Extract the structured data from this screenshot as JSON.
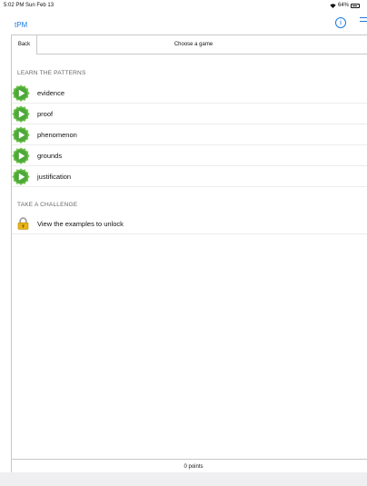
{
  "status_bar": {
    "time": "5:02 PM  Sun Feb 13",
    "battery": "64%"
  },
  "nav": {
    "title": "tPM"
  },
  "header": {
    "back_label": "Back",
    "title": "Choose a game"
  },
  "sections": {
    "learn": {
      "label": "LEARN THE PATTERNS",
      "items": [
        {
          "label": "evidence"
        },
        {
          "label": "proof"
        },
        {
          "label": "phenomenon"
        },
        {
          "label": "grounds"
        },
        {
          "label": "justification"
        }
      ]
    },
    "challenge": {
      "label": "TAKE A CHALLENGE",
      "items": [
        {
          "label": "View the examples to unlock"
        }
      ]
    }
  },
  "footer": {
    "points": "0 points"
  },
  "colors": {
    "accent": "#1a7be0",
    "play_green": "#6cc24a",
    "lock_gold": "#e7b417"
  }
}
